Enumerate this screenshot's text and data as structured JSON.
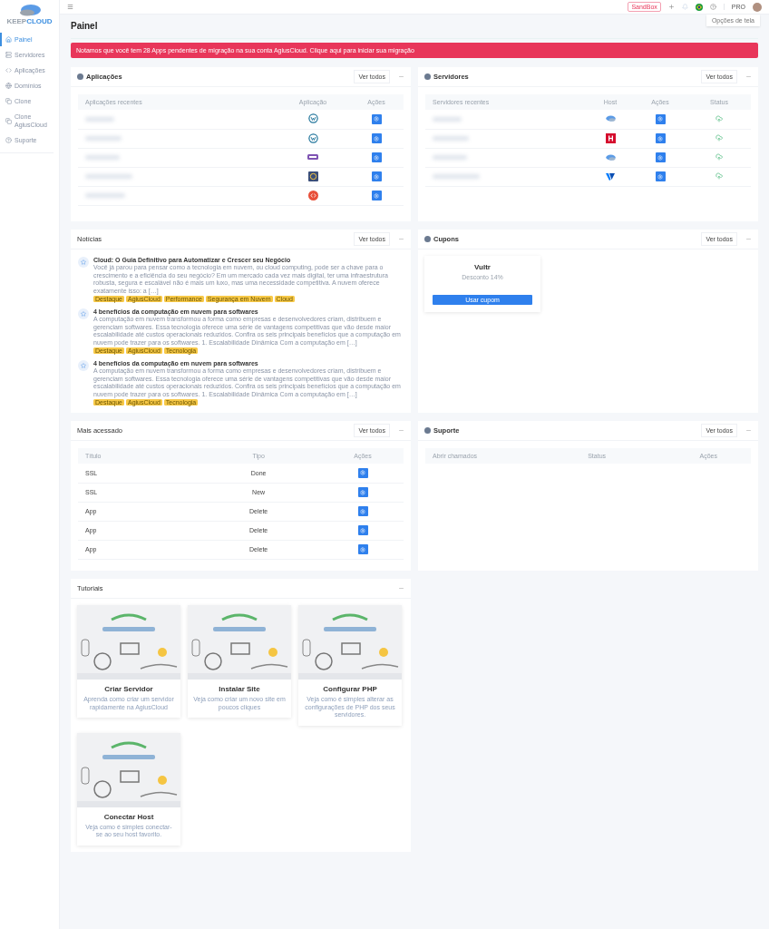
{
  "sidebar": {
    "logo": {
      "part1": "KEEP",
      "part2": "CLOUD"
    },
    "items": [
      {
        "label": "Painel",
        "selected": true
      },
      {
        "label": "Servidores",
        "selected": false
      },
      {
        "label": "Aplicações",
        "selected": false
      },
      {
        "label": "Domínios",
        "selected": false
      },
      {
        "label": "Clone",
        "selected": false
      },
      {
        "label": "Clone AgiusCloud",
        "selected": false
      },
      {
        "label": "Suporte",
        "selected": false
      }
    ]
  },
  "topbar": {
    "badge": "SandBox",
    "plan": "PRO",
    "screen_options": "Opções de tela"
  },
  "page_title": "Painel",
  "alert": "Notamos que você tem 28 Apps pendentes de migração na sua conta AgiusCloud. Clique aqui para iniciar sua migração",
  "applications": {
    "title": "Aplicações",
    "view_all": "Ver todos",
    "columns": [
      "Aplicações recentes",
      "Aplicação",
      "Ações"
    ],
    "rows": [
      {
        "kind": "wordpress"
      },
      {
        "kind": "wordpress"
      },
      {
        "kind": "woocommerce"
      },
      {
        "kind": "generic"
      },
      {
        "kind": "code"
      }
    ]
  },
  "servers": {
    "title": "Servidores",
    "view_all": "Ver todos",
    "columns": [
      "Servidores recentes",
      "Host",
      "Ações",
      "Status"
    ],
    "rows": [
      {
        "kind": "cloud"
      },
      {
        "kind": "hosting"
      },
      {
        "kind": "cloud"
      },
      {
        "kind": "vultr"
      }
    ]
  },
  "news": {
    "title": "Notícias",
    "view_all": "Ver todos",
    "items": [
      {
        "title": "Cloud: O Guia Definitivo para Automatizar e Crescer seu Negócio",
        "excerpt": "Você já parou para pensar como a tecnologia em nuvem, ou cloud computing, pode ser a chave para o crescimento e a eficiência do seu negócio? Em um mercado cada vez mais digital, ter uma infraestrutura robusta, segura e escalável não é mais um luxo, mas uma necessidade competitiva. A nuvem oferece exatamente isso: a […]",
        "tags": [
          "Destaque",
          "AgiusCloud",
          "Performance",
          "Segurança em Nuvem",
          "Cloud"
        ]
      },
      {
        "title": "4 benefícios da computação em nuvem para softwares",
        "excerpt": "A computação em nuvem transformou a forma como empresas e desenvolvedores criam, distribuem e gerenciam softwares. Essa tecnologia oferece uma série de vantagens competitivas que vão desde maior escalabilidade até custos operacionais reduzidos. Confira os seis principais benefícios que a computação em nuvem pode trazer para os softwares. 1. Escalabilidade Dinâmica Com a computação em […]",
        "tags": [
          "Destaque",
          "AgiusCloud",
          "Tecnologia"
        ]
      },
      {
        "title": "4 benefícios da computação em nuvem para softwares",
        "excerpt": "A computação em nuvem transformou a forma como empresas e desenvolvedores criam, distribuem e gerenciam softwares. Essa tecnologia oferece uma série de vantagens competitivas que vão desde maior escalabilidade até custos operacionais reduzidos. Confira os seis principais benefícios que a computação em nuvem pode trazer para os softwares. 1. Escalabilidade Dinâmica Com a computação em […]",
        "tags": [
          "Destaque",
          "AgiusCloud",
          "Tecnologia"
        ]
      }
    ]
  },
  "coupons": {
    "title": "Cupons",
    "view_all": "Ver todos",
    "items": [
      {
        "name": "Vultr",
        "discount": "Desconto 14%",
        "button": "Usar cupom"
      }
    ]
  },
  "most_accessed": {
    "title": "Mais acessado",
    "view_all": "Ver todos",
    "columns": [
      "Título",
      "Tipo",
      "Ações"
    ],
    "rows": [
      {
        "title": "SSL",
        "type": "Done"
      },
      {
        "title": "SSL",
        "type": "New"
      },
      {
        "title": "App",
        "type": "Delete"
      },
      {
        "title": "App",
        "type": "Delete"
      },
      {
        "title": "App",
        "type": "Delete"
      }
    ]
  },
  "support": {
    "title": "Suporte",
    "view_all": "Ver todos",
    "columns": [
      "Abrir chamados",
      "Status",
      "Ações"
    ]
  },
  "tutorials": {
    "title": "Tutoriais",
    "items": [
      {
        "title": "Criar Servidor",
        "description": "Aprenda como criar um servidor rapidamente na AgiusCloud"
      },
      {
        "title": "Instalar Site",
        "description": "Veja como criar um novo site em poucos cliques"
      },
      {
        "title": "Configurar PHP",
        "description": "Veja como é simples alterar as configurações de PHP dos seus servidores."
      },
      {
        "title": "Conectar Host",
        "description": "Veja como é simples conectar-se ao seu host favorito."
      }
    ]
  }
}
